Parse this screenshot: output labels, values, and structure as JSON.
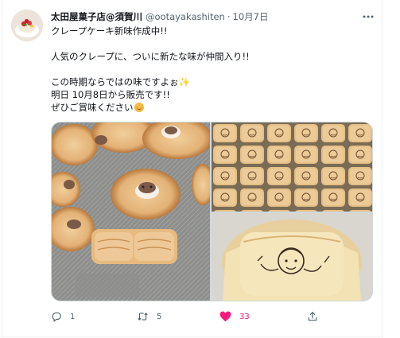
{
  "tweet": {
    "author": {
      "display_name": "太田屋菓子店@須賀川",
      "handle": "@ootayakashiten",
      "separator": "·",
      "timestamp": "10月7日"
    },
    "text": {
      "line1": "クレープケーキ新味作成中!!",
      "line2": "人気のクレープに、ついに新たな味が仲間入り!!",
      "line3": "この時期ならではの味ですよぉ",
      "line4": "明日 10月8日から販売です!!",
      "line5": "ぜひご賞味ください"
    },
    "emoji": {
      "sparkle": "✨",
      "smile": "smiling-face"
    },
    "media": [
      {
        "name": "crepe-cakes-on-tray-photo"
      },
      {
        "name": "crepe-rows-in-box-photo"
      },
      {
        "name": "crepe-with-face-stamp-photo"
      }
    ],
    "actions": {
      "reply_count": "1",
      "retweet_count": "5",
      "like_count": "33"
    },
    "colors": {
      "text_primary": "#0f1419",
      "text_secondary": "#536471",
      "like_pink": "#f91880",
      "border": "#cfd9de"
    },
    "icons": [
      "more-icon",
      "reply-icon",
      "retweet-icon",
      "heart-icon",
      "share-icon"
    ]
  }
}
